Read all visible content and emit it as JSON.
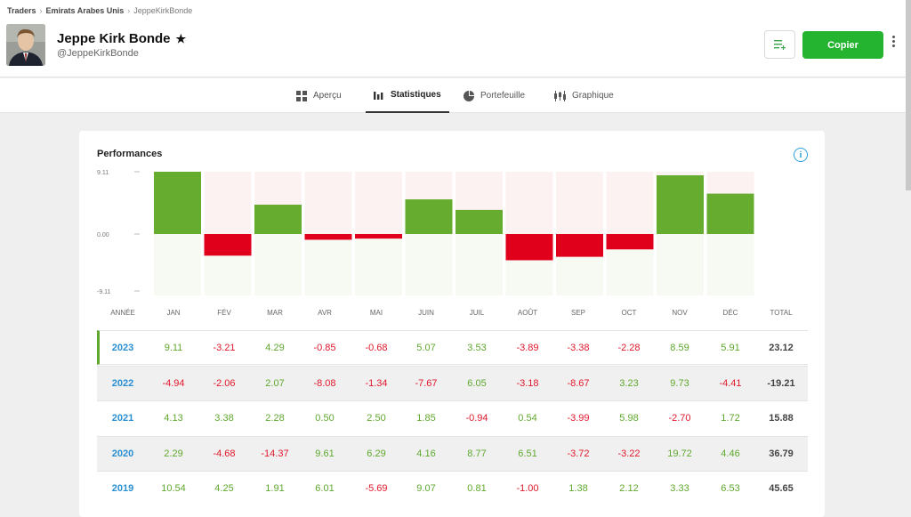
{
  "breadcrumb": {
    "items": [
      "Traders",
      "Emirats Arabes Unis",
      "JeppeKirkBonde"
    ]
  },
  "profile": {
    "name": "Jeppe Kirk Bonde",
    "handle": "@JeppeKirkBonde"
  },
  "actions": {
    "copy_label": "Copier"
  },
  "tabs": [
    {
      "label": "Aperçu",
      "icon": "grid-icon"
    },
    {
      "label": "Statistiques",
      "icon": "bar-chart-icon",
      "active": true
    },
    {
      "label": "Portefeuille",
      "icon": "pie-chart-icon"
    },
    {
      "label": "Graphique",
      "icon": "candlestick-icon"
    }
  ],
  "performance": {
    "title": "Performances",
    "headers": [
      "ANNÉE",
      "JAN",
      "FÉV",
      "MAR",
      "AVR",
      "MAI",
      "JUIN",
      "JUIL",
      "AOÛT",
      "SEP",
      "OCT",
      "NOV",
      "DÉC",
      "TOTAL"
    ],
    "rows": [
      {
        "year": "2023",
        "values": [
          "9.11",
          "-3.21",
          "4.29",
          "-0.85",
          "-0.68",
          "5.07",
          "3.53",
          "-3.89",
          "-3.38",
          "-2.28",
          "8.59",
          "5.91"
        ],
        "total": "23.12"
      },
      {
        "year": "2022",
        "values": [
          "-4.94",
          "-2.06",
          "2.07",
          "-8.08",
          "-1.34",
          "-7.67",
          "6.05",
          "-3.18",
          "-8.67",
          "3.23",
          "9.73",
          "-4.41"
        ],
        "total": "-19.21"
      },
      {
        "year": "2021",
        "values": [
          "4.13",
          "3.38",
          "2.28",
          "0.50",
          "2.50",
          "1.85",
          "-0.94",
          "0.54",
          "-3.99",
          "5.98",
          "-2.70",
          "1.72"
        ],
        "total": "15.88"
      },
      {
        "year": "2020",
        "values": [
          "2.29",
          "-4.68",
          "-14.37",
          "9.61",
          "6.29",
          "4.16",
          "8.77",
          "6.51",
          "-3.72",
          "-3.22",
          "19.72",
          "4.46"
        ],
        "total": "36.79"
      },
      {
        "year": "2019",
        "values": [
          "10.54",
          "4.25",
          "1.91",
          "6.01",
          "-5.69",
          "9.07",
          "0.81",
          "-1.00",
          "1.38",
          "2.12",
          "3.33",
          "6.53"
        ],
        "total": "45.65"
      }
    ]
  },
  "chart_data": {
    "type": "bar",
    "categories": [
      "JAN",
      "FÉV",
      "MAR",
      "AVR",
      "MAI",
      "JUIN",
      "JUIL",
      "AOÛT",
      "SEP",
      "OCT",
      "NOV",
      "DÉC"
    ],
    "values": [
      9.11,
      -3.21,
      4.29,
      -0.85,
      -0.68,
      5.07,
      3.53,
      -3.89,
      -3.38,
      -2.28,
      8.59,
      5.91
    ],
    "ytick_labels": [
      "9.11",
      "0.00",
      "-9.11"
    ],
    "ylim": [
      -9.11,
      9.11
    ],
    "colors": {
      "positive": "#66ac2e",
      "negative": "#e0001b",
      "bg_pos": "#fdf2f2",
      "bg_neg": "#f6faf3"
    }
  }
}
